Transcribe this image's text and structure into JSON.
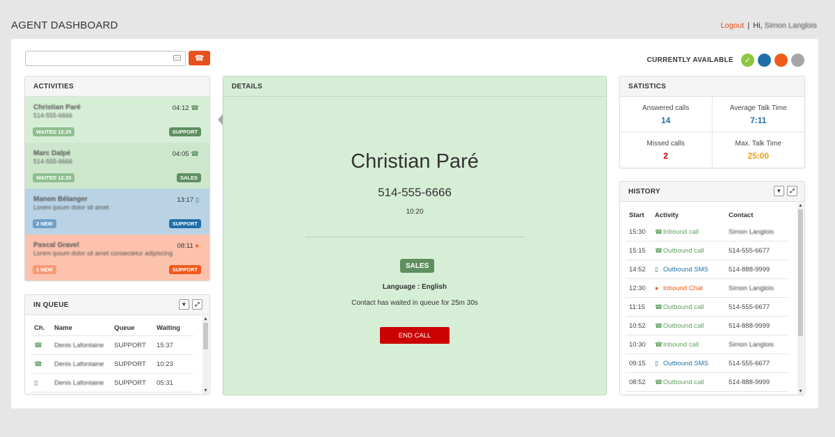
{
  "header": {
    "title": "AGENT DASHBOARD",
    "logout": "Logout",
    "separator": "|",
    "greeting": "Hi,",
    "user_name": "Simon Langlois"
  },
  "toolbar": {
    "search_value": "",
    "search_placeholder": "",
    "call_icon": "phone-icon"
  },
  "availability": {
    "label": "CURRENTLY AVAILABLE",
    "states": [
      {
        "icon": "check-icon",
        "color": "#8cc63f"
      },
      {
        "icon": "",
        "color": "#1f6fa8"
      },
      {
        "icon": "",
        "color": "#f05a1a"
      },
      {
        "icon": "",
        "color": "#a6a6a6"
      }
    ]
  },
  "activities": {
    "title": "ACTIVITIES",
    "items": [
      {
        "name": "Christian Paré",
        "sub": "514-555-6666",
        "time": "04:12",
        "icon": "phone-icon",
        "left_badge": "WAITED 12:25",
        "right_badge": "SUPPORT",
        "bg": "#d6eed6",
        "left_color": "#8fbf8f",
        "right_color": "#5f8f5f"
      },
      {
        "name": "Marc Dalpé",
        "sub": "514-555-6666",
        "time": "04:05",
        "icon": "phone-icon",
        "left_badge": "WAITED 12:25",
        "right_badge": "SALES",
        "bg": "#cde7cd",
        "left_color": "#8fbf8f",
        "right_color": "#5f8f5f"
      },
      {
        "name": "Manon Bélanger",
        "sub": "Lorem ipsum dolor sit amet",
        "time": "13:17",
        "icon": "mobile-icon",
        "left_badge": "2 NEW",
        "right_badge": "SUPPORT",
        "bg": "#b9d3e4",
        "left_color": "#6fa0c8",
        "right_color": "#1f6fa8"
      },
      {
        "name": "Pascal Gravel",
        "sub": "Lorem ipsum dolor sit amet consectetur adipiscing",
        "time": "08:11",
        "icon": "chat-icon",
        "left_badge": "1 NEW",
        "right_badge": "SUPPORT",
        "bg": "#fcc2ad",
        "left_color": "#f59a77",
        "right_color": "#f05a1a"
      }
    ]
  },
  "queue": {
    "title": "IN QUEUE",
    "columns": [
      "Ch.",
      "Name",
      "Queue",
      "Waiting"
    ],
    "rows": [
      {
        "channel": "phone-icon",
        "name": "Denis Lafontaine",
        "queue": "SUPPORT",
        "waiting": "15:37"
      },
      {
        "channel": "phone-icon",
        "name": "Denis Lafontaine",
        "queue": "SUPPORT",
        "waiting": "10:23"
      },
      {
        "channel": "mobile-icon",
        "name": "Denis Lafontaine",
        "queue": "SUPPORT",
        "waiting": "05:31"
      }
    ]
  },
  "details": {
    "title": "DETAILS",
    "name": "Christian Paré",
    "phone": "514-555-6666",
    "time": "10:20",
    "badge": "SALES",
    "language": "Language : English",
    "wait_text": "Contact has waited in queue for 25m 30s",
    "end_button": "END CALL"
  },
  "statistics": {
    "title": "SATISTICS",
    "items": [
      {
        "label": "Answered calls",
        "value": "14",
        "color": "#1f6fa8"
      },
      {
        "label": "Average Talk Time",
        "value": "7:11",
        "color": "#1f6fa8"
      },
      {
        "label": "Missed calls",
        "value": "2",
        "color": "#cc0000"
      },
      {
        "label": "Max. Talk Time",
        "value": "25:00",
        "color": "#f39c12"
      }
    ]
  },
  "history": {
    "title": "HISTORY",
    "columns": [
      "Start",
      "Activity",
      "Contact"
    ],
    "rows": [
      {
        "start": "15:30",
        "activity": "Inbound call",
        "icon": "phone-icon",
        "color": "#5f9f5f",
        "contact": "Simon Langlois",
        "blur": true
      },
      {
        "start": "15:15",
        "activity": "Outbound call",
        "icon": "phone-icon",
        "color": "#5f9f5f",
        "contact": "514-555-6677",
        "blur": false
      },
      {
        "start": "14:52",
        "activity": "Outbound SMS",
        "icon": "mobile-icon",
        "color": "#1f6fa8",
        "contact": "514-888-9999",
        "blur": false
      },
      {
        "start": "12:30",
        "activity": "Inbound Chat",
        "icon": "chat-icon",
        "color": "#f05a1a",
        "contact": "Simon Langlois",
        "blur": true
      },
      {
        "start": "11:15",
        "activity": "Outbound call",
        "icon": "phone-icon",
        "color": "#5f9f5f",
        "contact": "514-555-6677",
        "blur": false
      },
      {
        "start": "10:52",
        "activity": "Outbound call",
        "icon": "phone-icon",
        "color": "#5f9f5f",
        "contact": "514-888-9999",
        "blur": false
      },
      {
        "start": "10:30",
        "activity": "Inbound call",
        "icon": "phone-icon",
        "color": "#5f9f5f",
        "contact": "Simon Langlois",
        "blur": true
      },
      {
        "start": "09:15",
        "activity": "Outbound SMS",
        "icon": "mobile-icon",
        "color": "#1f6fa8",
        "contact": "514-555-6677",
        "blur": false
      },
      {
        "start": "08:52",
        "activity": "Outbound call",
        "icon": "phone-icon",
        "color": "#5f9f5f",
        "contact": "514-888-9999",
        "blur": false
      }
    ]
  }
}
